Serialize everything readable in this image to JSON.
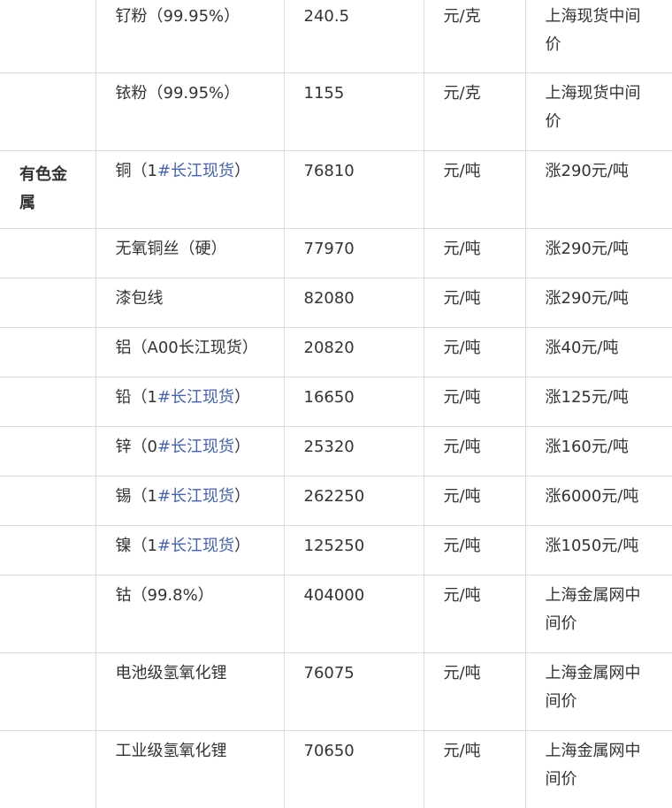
{
  "table": {
    "category_label": "有色金属",
    "rows": [
      {
        "name": "钌粉（99.95%）",
        "price": "240.5",
        "unit": "元/克",
        "change": "上海现货中间价"
      },
      {
        "name": "铱粉（99.95%）",
        "price": "1155",
        "unit": "元/克",
        "change": "上海现货中间价"
      },
      {
        "name_prefix": "铜（1",
        "name_link": "#长江现货",
        "name_suffix": "）",
        "price": "76810",
        "unit": "元/吨",
        "change": "涨290元/吨"
      },
      {
        "name": "无氧铜丝（硬）",
        "price": "77970",
        "unit": "元/吨",
        "change": "涨290元/吨"
      },
      {
        "name": "漆包线",
        "price": "82080",
        "unit": "元/吨",
        "change": "涨290元/吨"
      },
      {
        "name": "铝（A00长江现货）",
        "price": "20820",
        "unit": "元/吨",
        "change": "涨40元/吨"
      },
      {
        "name_prefix": "铅（1",
        "name_link": "#长江现货",
        "name_suffix": "）",
        "price": "16650",
        "unit": "元/吨",
        "change": "涨125元/吨"
      },
      {
        "name_prefix": "锌（0",
        "name_link": "#长江现货",
        "name_suffix": "）",
        "price": "25320",
        "unit": "元/吨",
        "change": "涨160元/吨"
      },
      {
        "name_prefix": "锡（1",
        "name_link": "#长江现货",
        "name_suffix": "）",
        "price": "262250",
        "unit": "元/吨",
        "change": "涨6000元/吨"
      },
      {
        "name_prefix": "镍（1",
        "name_link": "#长江现货",
        "name_suffix": "）",
        "price": "125250",
        "unit": "元/吨",
        "change": "涨1050元/吨"
      },
      {
        "name": "钴（99.8%）",
        "price": "404000",
        "unit": "元/吨",
        "change": "上海金属网中间价"
      },
      {
        "name": "电池级氢氧化锂",
        "price": "76075",
        "unit": "元/吨",
        "change": "上海金属网中间价"
      },
      {
        "name": "工业级氢氧化锂",
        "price": "70650",
        "unit": "元/吨",
        "change": "上海金属网中间价"
      }
    ]
  }
}
